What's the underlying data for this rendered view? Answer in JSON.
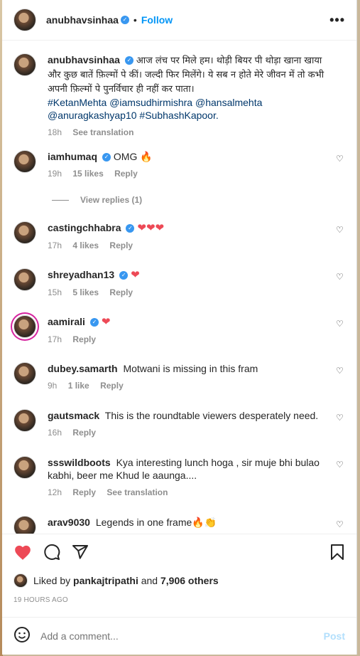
{
  "header": {
    "username": "anubhavsinhaa",
    "verified_mark": "✓",
    "separator": "•",
    "follow_label": "Follow",
    "more_label": "•••"
  },
  "caption": {
    "username": "anubhavsinhaa",
    "text": "आज लंच पर मिले हम। थोड़ी बियर पी थोड़ा खाना खाया और कुछ बातें फ़िल्मों पे कीं। जल्दी फिर मिलेंगे। ये सब न होते मेरे जीवन में तो कभी अपनी फ़िल्मों पे पुनर्विचार ही नहीं कर पाता।",
    "tags": [
      "#KetanMehta",
      "@iamsudhirmishra",
      "@hansalmehta",
      "@anuragkashyap10",
      "#SubhashKapoor."
    ],
    "time": "18h",
    "see_translation": "See translation"
  },
  "comments": [
    {
      "username": "iamhumaq",
      "verified": true,
      "text": "OMG 🔥",
      "time": "19h",
      "likes": "15 likes",
      "reply": "Reply"
    },
    {
      "username": "castingchhabra",
      "verified": true,
      "text": "❤❤❤",
      "time": "17h",
      "likes": "4 likes",
      "reply": "Reply"
    },
    {
      "username": "shreyadhan13",
      "verified": true,
      "text": "❤",
      "time": "15h",
      "likes": "5 likes",
      "reply": "Reply"
    },
    {
      "username": "aamirali",
      "verified": true,
      "text": "❤",
      "time": "17h",
      "likes": "",
      "reply": "Reply"
    },
    {
      "username": "dubey.samarth",
      "verified": false,
      "text": "Motwani is missing in this fram",
      "time": "9h",
      "likes": "1 like",
      "reply": "Reply"
    },
    {
      "username": "gautsmack",
      "verified": false,
      "text": "This is the roundtable viewers desperately need.",
      "time": "16h",
      "likes": "",
      "reply": "Reply"
    },
    {
      "username": "ssswildboots",
      "verified": false,
      "text": "Kya interesting lunch hoga , sir muje bhi bulao kabhi, beer me Khud le aaunga....",
      "time": "12h",
      "likes": "",
      "reply": "Reply",
      "see_translation": "See translation"
    },
    {
      "username": "arav9030",
      "verified": false,
      "text": "Legends in one frame🔥👏",
      "time": "",
      "likes": "",
      "reply": ""
    }
  ],
  "view_replies": "View replies (1)",
  "actions": {
    "like_icon": "heart-filled-icon",
    "comment_icon": "comment-icon",
    "share_icon": "share-icon",
    "save_icon": "bookmark-icon"
  },
  "liked_by": {
    "prefix": "Liked by",
    "user": "pankajtripathi",
    "and": "and",
    "others": "7,906 others"
  },
  "time_ago": "19 HOURS AGO",
  "add_comment": {
    "placeholder": "Add a comment...",
    "post_label": "Post"
  },
  "colors": {
    "accent": "#0095f6",
    "like_red": "#ed4956",
    "post_disabled": "#b2dffc",
    "muted": "#8e8e8e"
  }
}
